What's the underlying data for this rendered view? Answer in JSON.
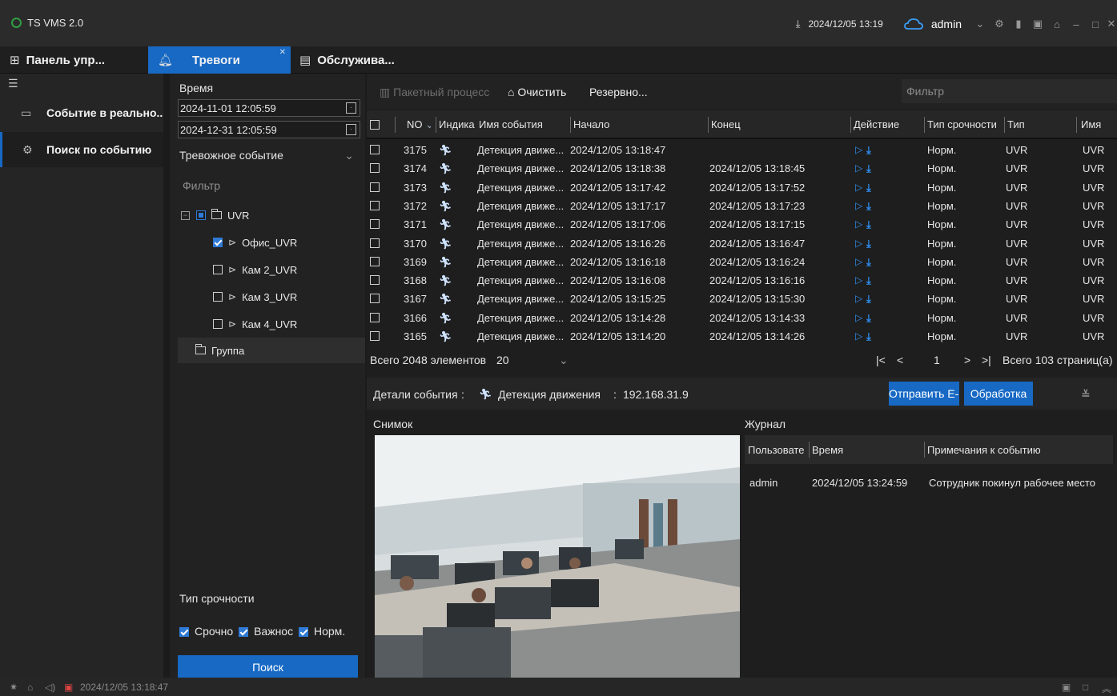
{
  "app": {
    "title": "TS VMS 2.0"
  },
  "titlebar": {
    "datetime": "2024/12/05 13:19",
    "user": "admin"
  },
  "topnav": {
    "tabs": [
      {
        "label": "Панель упр..."
      },
      {
        "label": "Тревоги"
      },
      {
        "label": "Обслужива..."
      }
    ]
  },
  "leftmenu": {
    "items": [
      {
        "label": "Событие в реально..."
      },
      {
        "label": "Поиск по событию"
      }
    ]
  },
  "filters": {
    "time_label": "Время",
    "start": "2024-11-01 12:05:59",
    "end": "2024-12-31 12:05:59",
    "event_type": "Тревожное событие",
    "filter_placeholder": "Фильтр",
    "tree": {
      "root": "UVR",
      "cameras": [
        "Офис_UVR",
        "Кам 2_UVR",
        "Кам 3_UVR",
        "Кам 4_UVR"
      ],
      "group": "Группа"
    },
    "priority_label": "Тип срочности",
    "priority_options": [
      "Срочно",
      "Важнос",
      "Норм."
    ],
    "search_button": "Поиск"
  },
  "toolbar": {
    "batch": "Пакетный процесс",
    "clear": "Очистить",
    "backup": "Резервно...",
    "filter_placeholder": "Фильтр"
  },
  "table": {
    "headers": [
      "NO",
      "Индика",
      "Имя события",
      "Начало",
      "Конец",
      "Действие",
      "Тип срочности",
      "Тип",
      "Имя"
    ],
    "rows": [
      {
        "no": "3175",
        "name": "Детекция движе...",
        "start": "2024/12/05 13:18:47",
        "end": "",
        "prio": "Норм.",
        "type": "UVR",
        "dev": "UVR"
      },
      {
        "no": "3174",
        "name": "Детекция движе...",
        "start": "2024/12/05 13:18:38",
        "end": "2024/12/05 13:18:45",
        "prio": "Норм.",
        "type": "UVR",
        "dev": "UVR"
      },
      {
        "no": "3173",
        "name": "Детекция движе...",
        "start": "2024/12/05 13:17:42",
        "end": "2024/12/05 13:17:52",
        "prio": "Норм.",
        "type": "UVR",
        "dev": "UVR"
      },
      {
        "no": "3172",
        "name": "Детекция движе...",
        "start": "2024/12/05 13:17:17",
        "end": "2024/12/05 13:17:23",
        "prio": "Норм.",
        "type": "UVR",
        "dev": "UVR"
      },
      {
        "no": "3171",
        "name": "Детекция движе...",
        "start": "2024/12/05 13:17:06",
        "end": "2024/12/05 13:17:15",
        "prio": "Норм.",
        "type": "UVR",
        "dev": "UVR"
      },
      {
        "no": "3170",
        "name": "Детекция движе...",
        "start": "2024/12/05 13:16:26",
        "end": "2024/12/05 13:16:47",
        "prio": "Норм.",
        "type": "UVR",
        "dev": "UVR"
      },
      {
        "no": "3169",
        "name": "Детекция движе...",
        "start": "2024/12/05 13:16:18",
        "end": "2024/12/05 13:16:24",
        "prio": "Норм.",
        "type": "UVR",
        "dev": "UVR"
      },
      {
        "no": "3168",
        "name": "Детекция движе...",
        "start": "2024/12/05 13:16:08",
        "end": "2024/12/05 13:16:16",
        "prio": "Норм.",
        "type": "UVR",
        "dev": "UVR"
      },
      {
        "no": "3167",
        "name": "Детекция движе...",
        "start": "2024/12/05 13:15:25",
        "end": "2024/12/05 13:15:30",
        "prio": "Норм.",
        "type": "UVR",
        "dev": "UVR"
      },
      {
        "no": "3166",
        "name": "Детекция движе...",
        "start": "2024/12/05 13:14:28",
        "end": "2024/12/05 13:14:33",
        "prio": "Норм.",
        "type": "UVR",
        "dev": "UVR"
      },
      {
        "no": "3165",
        "name": "Детекция движе...",
        "start": "2024/12/05 13:14:20",
        "end": "2024/12/05 13:14:26",
        "prio": "Норм.",
        "type": "UVR",
        "dev": "UVR"
      }
    ]
  },
  "pager": {
    "total": "Всего 2048 элементов",
    "page_size": "20",
    "page": "1",
    "pages": "Всего 103 страниц(а)"
  },
  "details": {
    "label": "Детали события",
    "event": "Детекция движения",
    "ip": "192.168.31.9",
    "send_button": "Отправить E-...",
    "process_button": "Обработка"
  },
  "snapshot": {
    "label": "Снимок"
  },
  "journal": {
    "label": "Журнал",
    "headers": [
      "Пользовате",
      "Время",
      "Примечания к событию"
    ],
    "rows": [
      {
        "user": "admin",
        "time": "2024/12/05 13:24:59",
        "note": "Сотрудник покинул рабочее место"
      }
    ]
  },
  "statusbar": {
    "datetime": "2024/12/05 13:18:47"
  },
  "colors": {
    "accent": "#1769c4",
    "action_icon": "#2f8ff0"
  }
}
